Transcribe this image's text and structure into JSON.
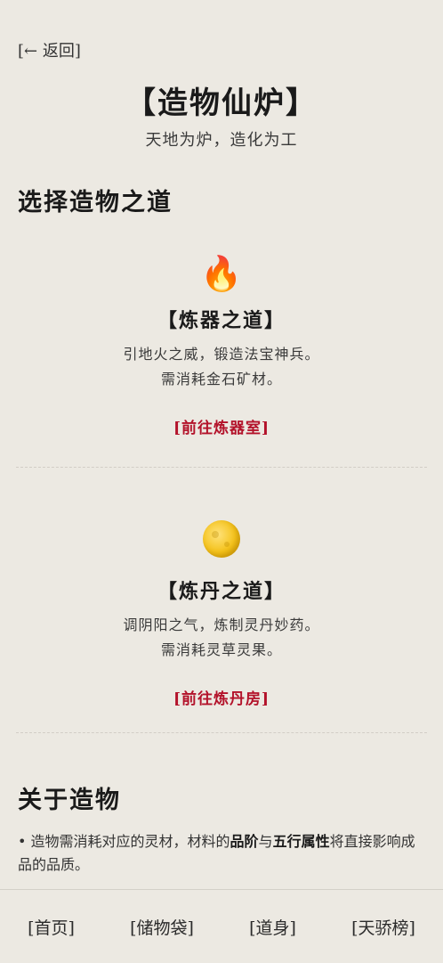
{
  "header": {
    "back_label": "[← 返回]",
    "title": "【造物仙炉】",
    "subtitle": "天地为炉，造化为工"
  },
  "choose_section": {
    "heading": "选择造物之道"
  },
  "ways": [
    {
      "icon": "fire-icon",
      "title": "【炼器之道】",
      "desc_line1": "引地火之威，锻造法宝神兵。",
      "desc_line2": "需消耗金石矿材。",
      "link": "[前往炼器室]"
    },
    {
      "icon": "moon-icon",
      "title": "【炼丹之道】",
      "desc_line1": "调阴阳之气，炼制灵丹妙药。",
      "desc_line2": "需消耗灵草灵果。",
      "link": "[前往炼丹房]"
    }
  ],
  "about": {
    "heading": "关于造物",
    "text_prefix": "• 造物需消耗对应的灵材，材料的",
    "bold1": "品阶",
    "text_mid": "与",
    "bold2": "五行属性",
    "text_suffix": "将直接影响成品的品质。"
  },
  "nav": {
    "items": [
      "[首页]",
      "[储物袋]",
      "[道身]",
      "[天骄榜]"
    ]
  },
  "colors": {
    "accent_red": "#b3122a",
    "background": "#ece9e2"
  }
}
